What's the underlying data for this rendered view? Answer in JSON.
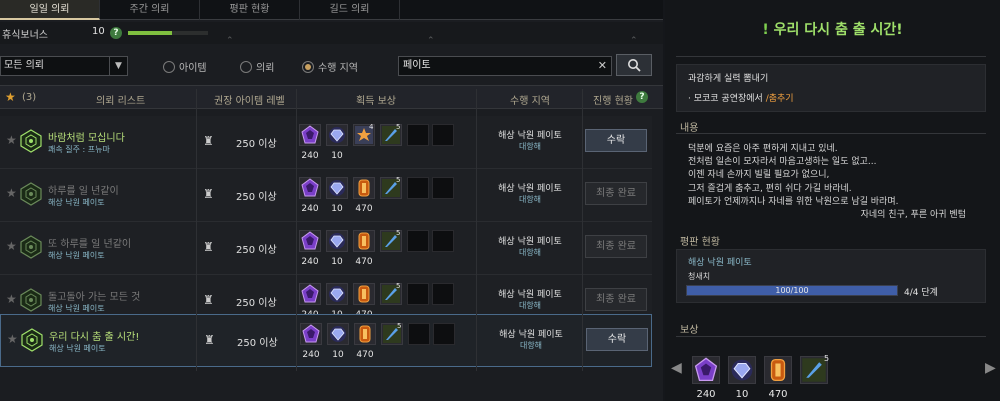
{
  "tabs": [
    "일일 의뢰",
    "주간 의뢰",
    "평판 현황",
    "길드 의뢰"
  ],
  "rest_bonus": {
    "label": "휴식보너스",
    "value": "10",
    "help": "?",
    "progress": 0.55
  },
  "filter": {
    "select": "모든 의뢰",
    "radios": [
      {
        "label": "아이템",
        "on": false
      },
      {
        "label": "의뢰",
        "on": false
      },
      {
        "label": "수행 지역",
        "on": true
      }
    ],
    "search_value": "페이토"
  },
  "header": {
    "star_count": "(3)",
    "quest_list": "의뢰 리스트",
    "rec_level": "권장 아이템 레벨",
    "reward": "획득 보상",
    "region": "수행 지역",
    "progress": "진행 현황"
  },
  "rows": [
    {
      "title": "바람처럼 모십니다",
      "sub": "쾌속 질주 : 프뉴마",
      "title_color": "#b8e07a",
      "level": "250 이상",
      "counts": [
        "240",
        "10",
        "",
        ""
      ],
      "region": "해상 낙원 페이토",
      "region_sub": "대항해",
      "button": "수락",
      "done": false,
      "selected": false,
      "items": [
        "purple",
        "blue",
        "star",
        "feather"
      ],
      "badge3": "4",
      "badge4": "5"
    },
    {
      "title": "하루를 일 년같이",
      "sub": "해상 낙원 페이토",
      "title_color": "#7a7a7a",
      "level": "250 이상",
      "counts": [
        "240",
        "10",
        "470",
        ""
      ],
      "region": "해상 낙원 페이토",
      "region_sub": "대항해",
      "button": "최종 완료",
      "done": true,
      "selected": false,
      "items": [
        "purple",
        "blue",
        "orange",
        "feather"
      ],
      "badge4": "5"
    },
    {
      "title": "또 하루를 일 년같이",
      "sub": "해상 낙원 페이토",
      "title_color": "#7a7a7a",
      "level": "250 이상",
      "counts": [
        "240",
        "10",
        "470",
        ""
      ],
      "region": "해상 낙원 페이토",
      "region_sub": "대항해",
      "button": "최종 완료",
      "done": true,
      "selected": false,
      "items": [
        "purple",
        "blue",
        "orange",
        "feather"
      ],
      "badge4": "5"
    },
    {
      "title": "돌고돌아 가는 모든 것",
      "sub": "해상 낙원 페이토",
      "title_color": "#7a7a7a",
      "level": "250 이상",
      "counts": [
        "240",
        "10",
        "470",
        ""
      ],
      "region": "해상 낙원 페이토",
      "region_sub": "대항해",
      "button": "최종 완료",
      "done": true,
      "selected": false,
      "items": [
        "purple",
        "blue",
        "orange",
        "feather"
      ],
      "badge4": "5"
    },
    {
      "title": "우리 다시 춤 출 시간!",
      "sub": "해상 낙원 페이토",
      "title_color": "#b8e07a",
      "level": "250 이상",
      "counts": [
        "240",
        "10",
        "470",
        ""
      ],
      "region": "해상 낙원 페이토",
      "region_sub": "대항해",
      "button": "수락",
      "done": false,
      "selected": true,
      "items": [
        "purple",
        "blue",
        "orange",
        "feather"
      ],
      "badge4": "5"
    }
  ],
  "detail": {
    "title": "우리 다시 춤 출 시간!",
    "objective": "과감하게 실력 뽐내기",
    "task_prefix": "· 모코코 공연장에서 ",
    "task_highlight": "/춤추기",
    "content_label": "내용",
    "body": [
      "덕분에 요즘은 아주 편하게 지내고 있네.",
      "전처럼 일손이 모자라서 마음고생하는 일도 없고...",
      "이젠 자네 손까지 빌릴 필요가 없으니,",
      "그저 즐겁게 춤추고, 편히 쉬다 가길 바라네.",
      "페이토가 언제까지나 자네를 위한 낙원으로 남길 바라며."
    ],
    "signature": "자네의 친구, 푸른 아귀 벤텀",
    "rep_label": "평판 현황",
    "rep_name": "해상 낙원 페이토",
    "rep_rank": "청새치",
    "rep_progress": "100/100",
    "rep_ratio": 1.0,
    "rep_stage": "4/4 단계",
    "reward_label": "보상",
    "reward_counts": [
      "240",
      "10",
      "470",
      ""
    ],
    "reward_badge": "5"
  },
  "colors": {
    "accent_green": "#9fe06a",
    "highlight_orange": "#f0a040",
    "sub_blue": "#8ab8c8"
  }
}
